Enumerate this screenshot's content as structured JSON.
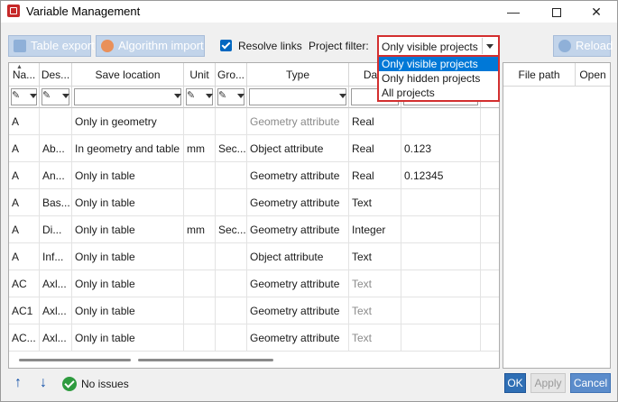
{
  "window": {
    "title": "Variable Management"
  },
  "toolbar": {
    "table_export": "Table export",
    "algorithm_import": "Algorithm import",
    "resolve_links": "Resolve links",
    "resolve_links_checked": true,
    "project_filter_label": "Project filter:",
    "project_filter_value": "Only visible projects",
    "project_filter_options": [
      "Only visible projects",
      "Only hidden projects",
      "All projects"
    ],
    "reload": "Reload"
  },
  "table": {
    "columns": [
      "Na...",
      "Des...",
      "Save location",
      "Unit",
      "Gro...",
      "Type",
      "Data"
    ],
    "rows": [
      {
        "name": "A",
        "desc": "",
        "save": "Only in geometry",
        "unit": "",
        "group": "",
        "type": "Geometry attribute",
        "type_gray": true,
        "data": "Real",
        "data_gray": false,
        "value": ""
      },
      {
        "name": "A",
        "desc": "Ab...",
        "save": "In geometry and table",
        "unit": "mm",
        "group": "Sec...",
        "type": "Object attribute",
        "type_gray": false,
        "data": "Real",
        "data_gray": false,
        "value": "0.123"
      },
      {
        "name": "A",
        "desc": "An...",
        "save": "Only in table",
        "unit": "",
        "group": "",
        "type": "Geometry attribute",
        "type_gray": false,
        "data": "Real",
        "data_gray": false,
        "value": "0.12345"
      },
      {
        "name": "A",
        "desc": "Bas...",
        "save": "Only in table",
        "unit": "",
        "group": "",
        "type": "Geometry attribute",
        "type_gray": false,
        "data": "Text",
        "data_gray": false,
        "value": ""
      },
      {
        "name": "A",
        "desc": "Di...",
        "save": "Only in table",
        "unit": "mm",
        "group": "Sec...",
        "type": "Geometry attribute",
        "type_gray": false,
        "data": "Integer",
        "data_gray": false,
        "value": ""
      },
      {
        "name": "A",
        "desc": "Inf...",
        "save": "Only in table",
        "unit": "",
        "group": "",
        "type": "Object attribute",
        "type_gray": false,
        "data": "Text",
        "data_gray": false,
        "value": ""
      },
      {
        "name": "AC",
        "desc": "Axl...",
        "save": "Only in table",
        "unit": "",
        "group": "",
        "type": "Geometry attribute",
        "type_gray": false,
        "data": "Text",
        "data_gray": true,
        "value": ""
      },
      {
        "name": "AC1",
        "desc": "Axl...",
        "save": "Only in table",
        "unit": "",
        "group": "",
        "type": "Geometry attribute",
        "type_gray": false,
        "data": "Text",
        "data_gray": true,
        "value": ""
      },
      {
        "name": "AC...",
        "desc": "Axl...",
        "save": "Only in table",
        "unit": "",
        "group": "",
        "type": "Geometry attribute",
        "type_gray": false,
        "data": "Text",
        "data_gray": true,
        "value": ""
      }
    ]
  },
  "side_panel": {
    "columns": [
      "File path",
      "Open"
    ]
  },
  "footer": {
    "status_text": "No issues",
    "ok": "OK",
    "apply": "Apply",
    "cancel": "Cancel"
  },
  "colors": {
    "accent": "#0078d7",
    "highlight_border": "#d32f2f",
    "status_ok": "#2e9b3f"
  }
}
